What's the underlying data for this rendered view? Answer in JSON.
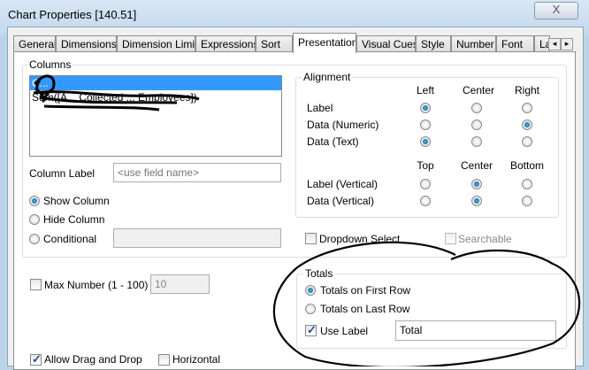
{
  "window": {
    "title": "Chart Properties [140.51]",
    "close_glyph": "X"
  },
  "tabs": [
    "General",
    "Dimensions",
    "Dimension Limits",
    "Expressions",
    "Sort",
    "Presentation",
    "Visual Cues",
    "Style",
    "Number",
    "Font",
    "La"
  ],
  "tab_scroll": {
    "left": "◂",
    "right": "▸"
  },
  "columns": {
    "label": "Columns",
    "items": [
      "C...",
      "Sum([A... Collected ... Employees])"
    ],
    "column_label": "Column Label",
    "column_label_placeholder": "<use field name>",
    "show_column": "Show Column",
    "hide_column": "Hide Column",
    "conditional": "Conditional",
    "visibility": "show"
  },
  "alignment": {
    "label": "Alignment",
    "cols": [
      "Left",
      "Center",
      "Right"
    ],
    "rows": [
      {
        "label": "Label",
        "value": "Left"
      },
      {
        "label": "Data (Numeric)",
        "value": "Right"
      },
      {
        "label": "Data (Text)",
        "value": "Left"
      }
    ],
    "vcols": [
      "Top",
      "Center",
      "Bottom"
    ],
    "vrows": [
      {
        "label": "Label (Vertical)",
        "value": "Center"
      },
      {
        "label": "Data (Vertical)",
        "value": "Center"
      }
    ]
  },
  "dropdown_select": "Dropdown Select",
  "searchable": "Searchable",
  "max_number": {
    "label": "Max Number (1 - 100)",
    "value": "10",
    "checked": false
  },
  "totals": {
    "label": "Totals",
    "first_row": "Totals on First Row",
    "last_row": "Totals on Last Row",
    "selected": "first",
    "use_label": "Use Label",
    "use_label_checked": true,
    "label_value": "Total"
  },
  "bottom": {
    "allow_drag": "Allow Drag and Drop",
    "horizontal": "Horizontal"
  }
}
